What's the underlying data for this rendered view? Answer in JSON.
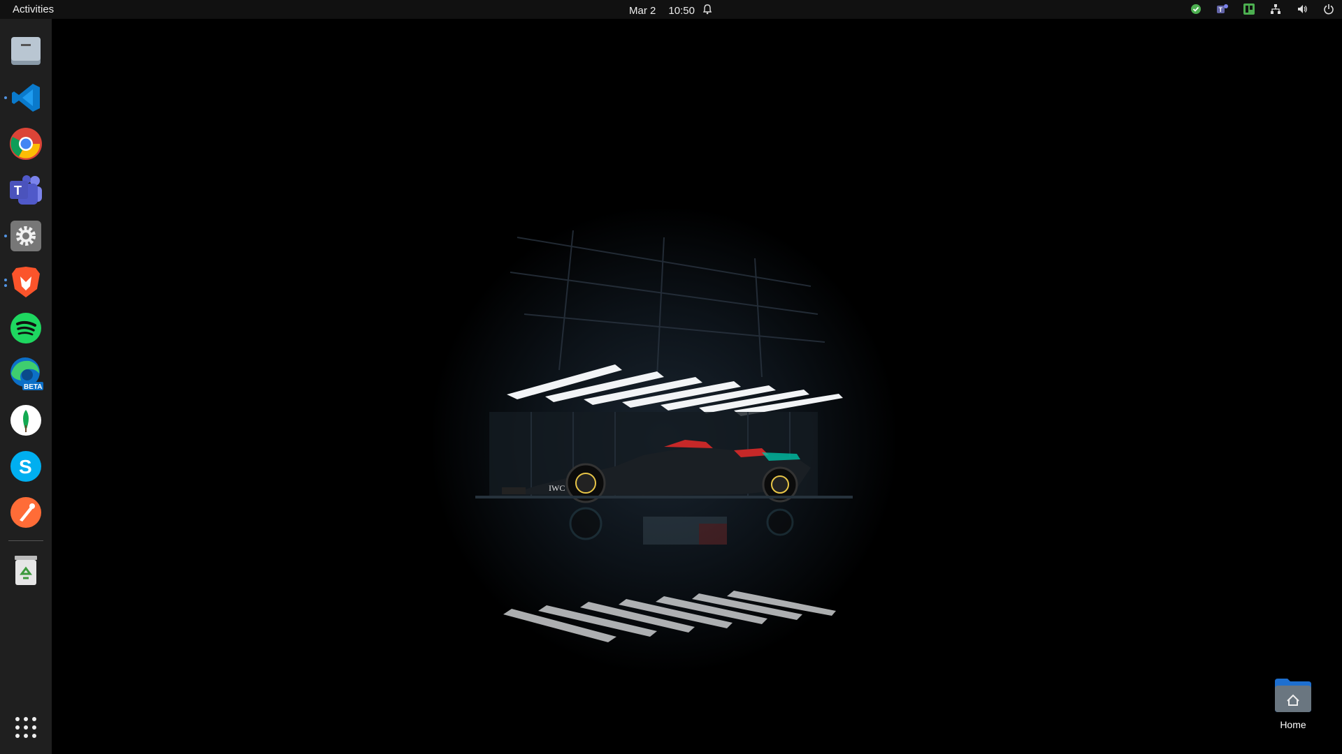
{
  "topbar": {
    "activities_label": "Activities",
    "date": "Mar 2",
    "time": "10:50",
    "tray_icons": [
      "status-check-icon",
      "teams-tray-icon",
      "trello-tray-icon",
      "network-icon",
      "volume-icon",
      "power-icon"
    ]
  },
  "dock": {
    "apps": [
      {
        "name": "Files",
        "icon": "files-icon",
        "running": false
      },
      {
        "name": "Visual Studio Code",
        "icon": "vscode-icon",
        "running": true
      },
      {
        "name": "Google Chrome",
        "icon": "chrome-icon",
        "running": false
      },
      {
        "name": "Microsoft Teams",
        "icon": "teams-icon",
        "running": false
      },
      {
        "name": "Settings",
        "icon": "settings-icon",
        "running": true
      },
      {
        "name": "Brave",
        "icon": "brave-icon",
        "running": true
      },
      {
        "name": "Spotify",
        "icon": "spotify-icon",
        "running": false
      },
      {
        "name": "Microsoft Edge Beta",
        "icon": "edge-beta-icon",
        "running": false,
        "badge": "BETA"
      },
      {
        "name": "MongoDB Compass",
        "icon": "mongodb-icon",
        "running": false
      },
      {
        "name": "Skype",
        "icon": "skype-icon",
        "running": false
      },
      {
        "name": "Postman",
        "icon": "postman-icon",
        "running": false
      },
      {
        "name": "Trash",
        "icon": "trash-icon",
        "running": false
      }
    ],
    "show_apps_icon": "app-grid-icon"
  },
  "desktop": {
    "home_label": "Home"
  },
  "colors": {
    "topbar_bg": "#111111",
    "dock_bg": "#1f1f1f",
    "running_indicator": "#5294e2",
    "accent_green": "#4caf50"
  }
}
